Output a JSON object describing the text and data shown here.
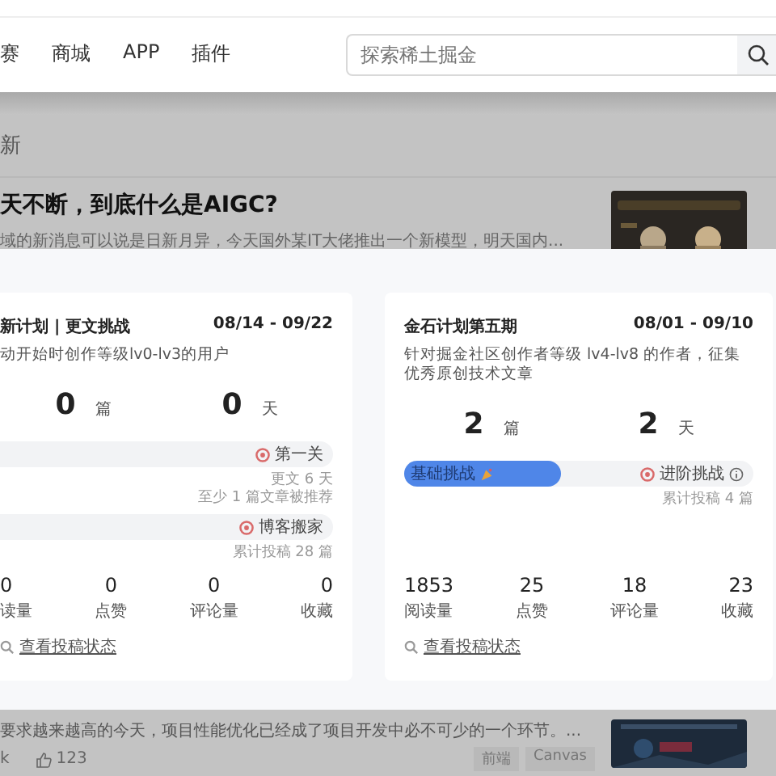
{
  "nav": {
    "items": [
      "赛",
      "商城",
      "APP",
      "插件"
    ],
    "search": {
      "placeholder": "探索稀土掘金"
    }
  },
  "feed": {
    "section_title": "新",
    "article": {
      "title": "天不断，到底什么是AIGC?",
      "excerpt": "域的新消息可以说是日新月异，今天国外某IT大佬推出一个新模型，明天国内..."
    }
  },
  "modal": {
    "cards": [
      {
        "title": "新计划 | 更文挑战",
        "date": "08/14 - 09/22",
        "description": "动开始时创作等级lv0-lv3的用户",
        "stats": [
          {
            "value": "0",
            "unit": "篇"
          },
          {
            "value": "0",
            "unit": "天"
          }
        ],
        "tracks": [
          {
            "level": 0,
            "goal": "第一关",
            "notes": [
              "更文 6 天",
              "至少 1 篇文章被推荐"
            ]
          },
          {
            "level": 0,
            "goal": "博客搬家",
            "notes": [
              "累计投稿 28 篇"
            ]
          }
        ],
        "metrics": [
          {
            "value": "0",
            "label": "读量"
          },
          {
            "value": "0",
            "label": "点赞"
          },
          {
            "value": "0",
            "label": "评论量"
          },
          {
            "value": "0",
            "label": "收藏"
          }
        ],
        "link": "查看投稿状态"
      },
      {
        "title": "金石计划第五期",
        "date": "08/01 - 09/10",
        "description": "针对掘金社区创作者等级 lv4-lv8 的作者，征集优秀原创技术文章",
        "stats": [
          {
            "value": "2",
            "unit": "篇"
          },
          {
            "value": "2",
            "unit": "天"
          }
        ],
        "tracks": [
          {
            "level": 0.45,
            "label": "基础挑战",
            "goal": "进阶挑战",
            "info": true,
            "notes": [
              "累计投稿 4 篇"
            ]
          }
        ],
        "metrics": [
          {
            "value": "1853",
            "label": "阅读量"
          },
          {
            "value": "25",
            "label": "点赞"
          },
          {
            "value": "18",
            "label": "评论量"
          },
          {
            "value": "23",
            "label": "收藏"
          }
        ],
        "link": "查看投稿状态"
      }
    ]
  },
  "feed_bottom": {
    "excerpt": "要求越来越高的今天，项目性能优化已经成了项目开发中必不可少的一个环节。...",
    "author": "k",
    "likes": "123",
    "tags": [
      "前端",
      "Canvas"
    ]
  }
}
